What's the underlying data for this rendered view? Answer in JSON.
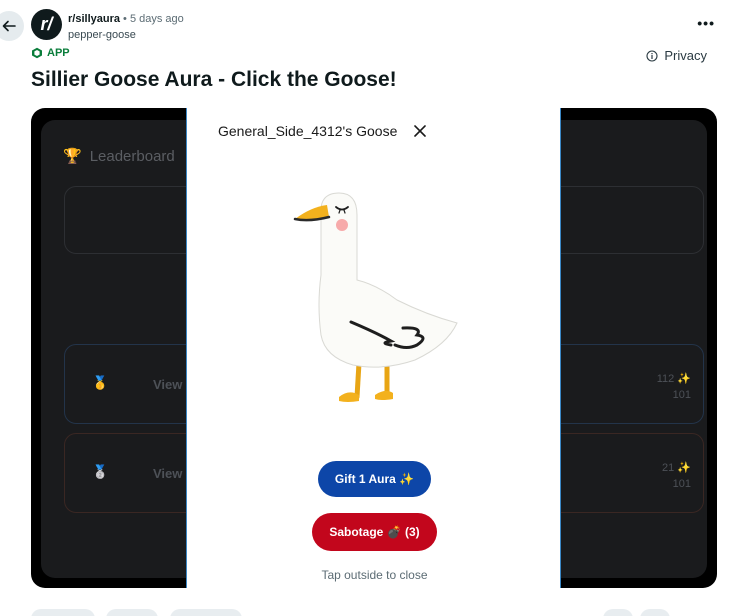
{
  "header": {
    "subreddit": "r/sillyaura",
    "subreddit_icon_text": "r/",
    "separator": "•",
    "time_ago": "5 days ago",
    "author": "pepper-goose",
    "more_label": "•••"
  },
  "badge": {
    "label": "APP"
  },
  "privacy": {
    "label": "Privacy"
  },
  "post": {
    "title": "Sillier Goose Aura - Click the Goose!"
  },
  "leaderboard": {
    "title": "Leaderboard",
    "rows": [
      {
        "view_label": "View",
        "aura": "112 ✨",
        "count": "101"
      },
      {
        "view_label": "View",
        "aura": "21 ✨",
        "count": "101"
      }
    ]
  },
  "modal": {
    "title": "General_Side_4312's Goose",
    "gift_label": "Gift 1 Aura ✨",
    "sabotage_label": "Sabotage 💣 (3)",
    "tap_close": "Tap outside to close"
  },
  "colors": {
    "gift_button": "#0d46a8",
    "sabotage_button": "#c2061c",
    "app_badge": "#0a7d3b"
  }
}
